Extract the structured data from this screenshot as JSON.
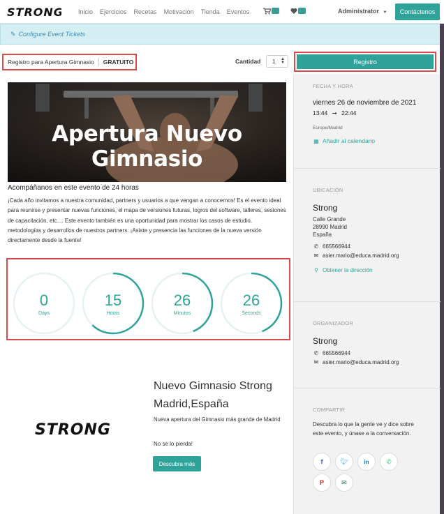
{
  "nav": {
    "brand": "STRONG",
    "links": [
      "Inicio",
      "Ejercicios",
      "Recetas",
      "Motivación",
      "Tienda",
      "Eventos"
    ],
    "cart_count": "1",
    "wishlist_count": "1",
    "user": "Administrator",
    "contact_label": "Contáctenos"
  },
  "configure": {
    "label": "Configure Event Tickets"
  },
  "ticket": {
    "name": "Registro para Apertura Gimnasio",
    "price": "GRATUITO",
    "quantity_label": "Cantidad",
    "quantity_value": "1",
    "register_label": "Registro"
  },
  "event": {
    "hero_title": "Apertura Nuevo Gimnasio",
    "subtitle": "Acompáñanos en este evento de 24 horas",
    "description": "¡Cada año invitamos a nuestra comunidad, partners y usuarios a que vengan a conocernos! Es el evento ideal para reunirse y presentar nuevas funciones, el mapa de versiones futuras, logros del software, talleres, sesiones de capacitación, etc.... Este evento también es una oportunidad para mostrar los casos de estudio, metodologías y desarrollos de nuestros partners. ¡Asiste y presencia las funciones de la nueva versión directamente desde la fuente!"
  },
  "countdown": {
    "days": {
      "value": "0",
      "label": "Days",
      "fraction": 0
    },
    "hours": {
      "value": "15",
      "label": "Horas",
      "fraction": 0.62
    },
    "minutes": {
      "value": "26",
      "label": "Minutos",
      "fraction": 0.44
    },
    "seconds": {
      "value": "26",
      "label": "Seconds",
      "fraction": 0.44
    },
    "accent": "#2fa39a"
  },
  "promo": {
    "logo": "STRONG",
    "title": "Nuevo Gimnasio Strong Madrid,España",
    "description": "Nueva apertura del Gimnasio más grande de Madrid",
    "note": "No se lo pierda!",
    "button_label": "Descubra más"
  },
  "sidebar": {
    "datetime": {
      "title": "FECHA Y HORA",
      "date": "viernes 26 de noviembre de 2021",
      "start": "13:44",
      "end": "22:44",
      "timezone": "Europe/Madrid",
      "calendar_link": "Añadir al calendario"
    },
    "location": {
      "title": "UBICACIÓN",
      "name": "Strong",
      "street": "Calle Grande",
      "city": "28990 Madrid",
      "country": "España",
      "phone": "665566944",
      "email": "asier.mario@educa.madrid.org",
      "directions": "Obtener la dirección"
    },
    "organizer": {
      "title": "ORGANIZADOR",
      "name": "Strong",
      "phone": "665566944",
      "email": "asier.mario@educa.madrid.org"
    },
    "share": {
      "title": "COMPARTIR",
      "text": "Descubra lo que la gente ve y dice sobre este evento, y únase a la conversación."
    }
  },
  "colors": {
    "brand": "#2fa39a",
    "highlight": "#d94a4a"
  }
}
